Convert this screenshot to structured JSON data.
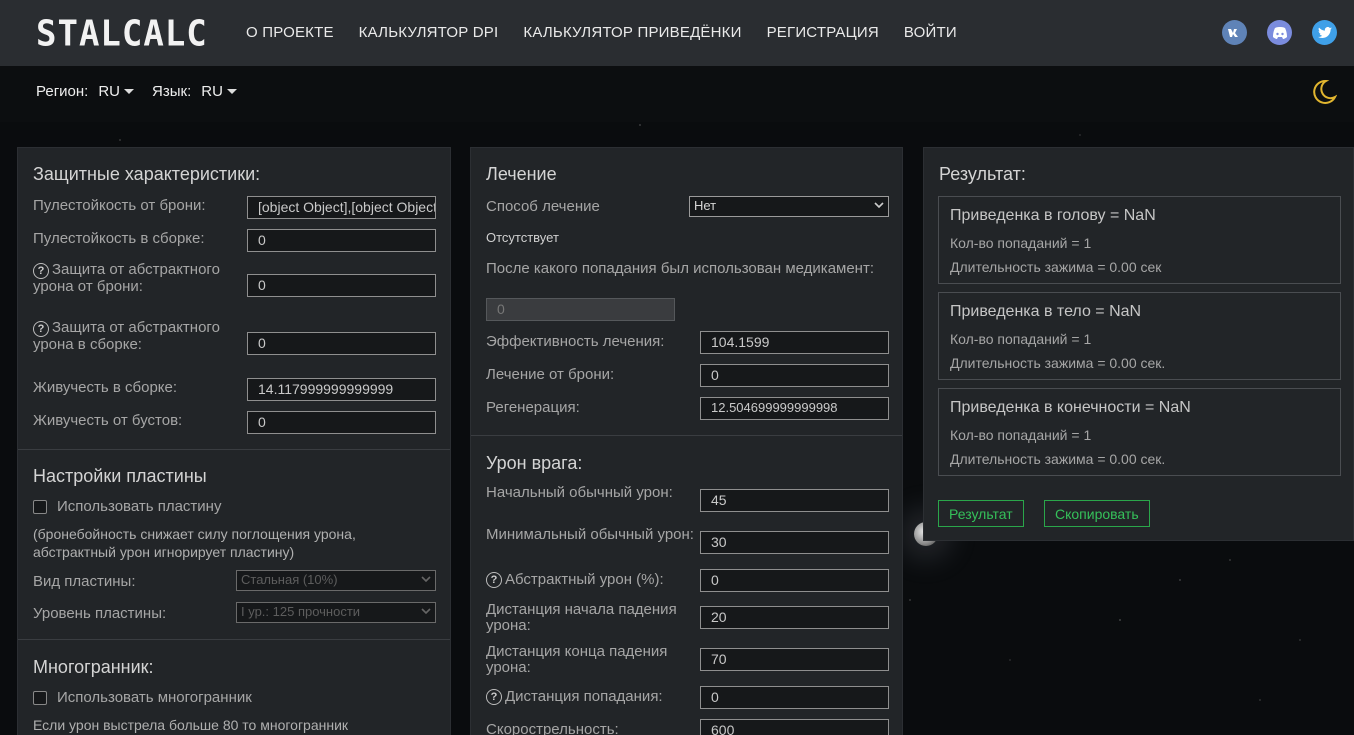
{
  "logo": "STALCALC",
  "nav": [
    {
      "label": "О ПРОЕКТЕ"
    },
    {
      "label": "КАЛЬКУЛЯТОР DPI"
    },
    {
      "label": "КАЛЬКУЛЯТОР ПРИВЕДЁНКИ"
    },
    {
      "label": "РЕГИСТРАЦИЯ"
    },
    {
      "label": "ВОЙТИ"
    }
  ],
  "social": {
    "vk": "vk",
    "discord": "discord",
    "twitter": "twitter"
  },
  "region": {
    "label": "Регион:",
    "value": "RU"
  },
  "language": {
    "label": "Язык:",
    "value": "RU"
  },
  "defense": {
    "title": "Защитные характеристики:",
    "armor_bullet_res": {
      "label": "Пулестойкость от брони:",
      "value": "[object Object],[object Object]"
    },
    "build_bullet_res": {
      "label": "Пулестойкость в сборке:",
      "value": "0"
    },
    "armor_abstract": {
      "label": "Защита от абстрактного урона от брони:",
      "value": "0"
    },
    "build_abstract": {
      "label": "Защита от абстрактного урона в сборке:",
      "value": "0"
    },
    "build_vitality": {
      "label": "Живучесть в сборке:",
      "value": "14.117999999999999"
    },
    "boost_vitality": {
      "label": "Живучесть от бустов:",
      "value": "0"
    }
  },
  "plate": {
    "title": "Настройки пластины",
    "use_label": "Использовать пластину",
    "note": "(бронебойность снижает силу поглощения урона, абстрактный урон игнорирует пластину)",
    "type": {
      "label": "Вид пластины:",
      "value": "Стальная (10%)"
    },
    "level": {
      "label": "Уровень пластины:",
      "value": "I ур.: 125 прочности"
    }
  },
  "polyhedron": {
    "title": "Многогранник:",
    "use_label": "Использовать многогранник",
    "note": "Если урон выстрела больше 80 то многогранник"
  },
  "healing": {
    "title": "Лечение",
    "method": {
      "label": "Способ лечение",
      "value": "Нет"
    },
    "absent": "Отсутствует",
    "after_hit": {
      "label": "После какого попадания был использован медикамент:",
      "value": "0"
    },
    "efficiency": {
      "label": "Эффективность лечения:",
      "value": "104.1599"
    },
    "armor_heal": {
      "label": "Лечение от брони:",
      "value": "0"
    },
    "regen": {
      "label": "Регенерация:",
      "value": "12.504699999999998"
    }
  },
  "enemy": {
    "title": "Урон врага:",
    "start_dmg": {
      "label": "Начальный обычный урон:",
      "value": "45"
    },
    "min_dmg": {
      "label": "Минимальный обычный урон:",
      "value": "30"
    },
    "abstract_dmg": {
      "label": "Абстрактный урон (%):",
      "value": "0"
    },
    "falloff_start": {
      "label": "Дистанция начала падения урона:",
      "value": "20"
    },
    "falloff_end": {
      "label": "Дистанция конца падения урона:",
      "value": "70"
    },
    "hit_distance": {
      "label": "Дистанция попадания:",
      "value": "0"
    },
    "rate_of_fire": {
      "label": "Скорострельность:",
      "value": "600"
    }
  },
  "result": {
    "title": "Результат:",
    "head": {
      "title": "Приведенка в голову = NaN",
      "hits": "Кол-во попаданий = 1",
      "hold": "Длительность зажима = 0.00 сек"
    },
    "body": {
      "title": "Приведенка в тело = NaN",
      "hits": "Кол-во попаданий = 1",
      "hold": "Длительность зажима = 0.00 сек."
    },
    "limbs": {
      "title": "Приведенка в конечности = NaN",
      "hits": "Кол-во попаданий = 1",
      "hold": "Длительность зажима = 0.00 сек."
    },
    "result_btn": "Результат",
    "copy_btn": "Скопировать"
  },
  "colors": {
    "accent_green": "#35c05a",
    "moon": "#e1b52f",
    "panel": "#222528"
  }
}
